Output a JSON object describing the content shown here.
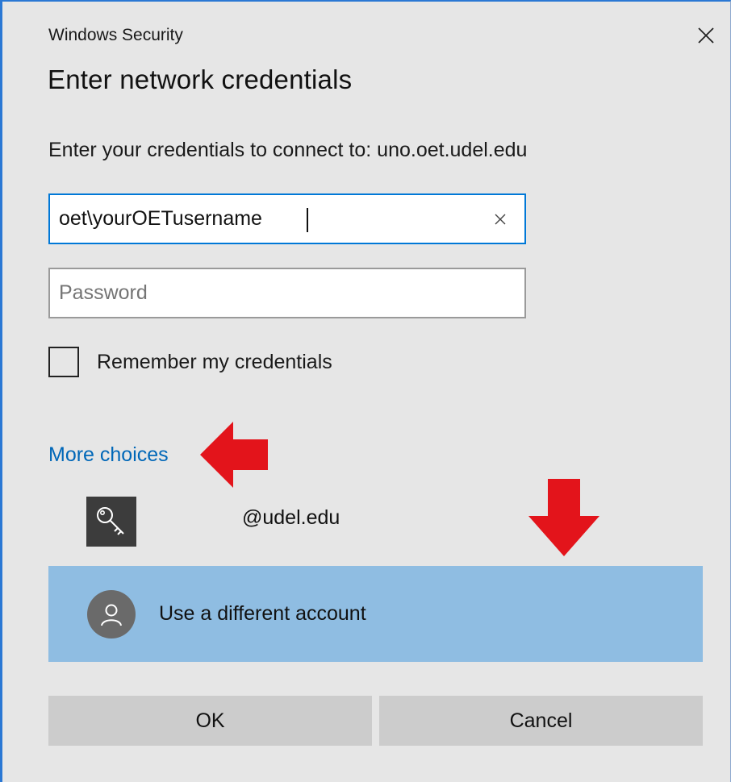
{
  "window": {
    "title": "Windows Security",
    "close_icon": "close-icon"
  },
  "dialog": {
    "heading": "Enter network credentials",
    "subtitle": "Enter your credentials to connect to: uno.oet.udel.edu"
  },
  "username": {
    "value": "oet\\yourOETusername",
    "clear_icon": "clear-icon"
  },
  "password": {
    "value": "",
    "placeholder": "Password"
  },
  "remember": {
    "label": "Remember my credentials",
    "checked": false
  },
  "more_choices": {
    "label": "More choices"
  },
  "accounts": [
    {
      "icon": "key-icon",
      "email": "@udel.edu"
    }
  ],
  "different_account": {
    "label": "Use a different account",
    "icon": "person-icon"
  },
  "buttons": {
    "ok": "OK",
    "cancel": "Cancel"
  },
  "annotations": {
    "arrow_color": "#e3141b",
    "arrows": [
      "arrow-left-icon",
      "arrow-down-icon"
    ]
  },
  "colors": {
    "accent": "#0078d7",
    "link": "#0067b8",
    "selected_row": "#8fbde2",
    "button": "#cccccc",
    "background": "#e6e6e6"
  }
}
